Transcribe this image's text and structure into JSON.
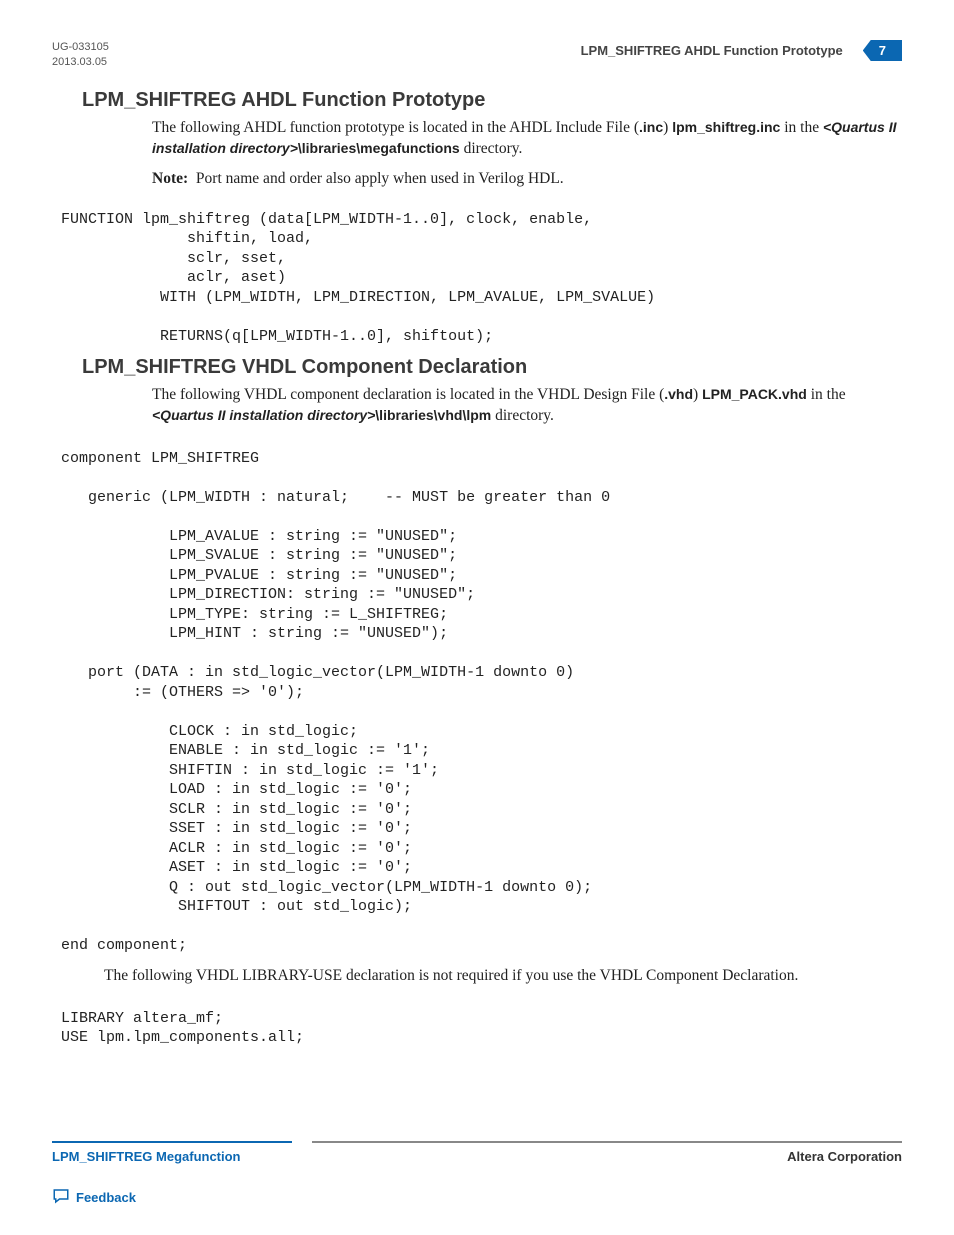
{
  "header": {
    "doc_id": "UG-033105",
    "date": "2013.03.05",
    "running_title": "LPM_SHIFTREG AHDL Function Prototype",
    "page_number": "7"
  },
  "section1": {
    "title": "LPM_SHIFTREG AHDL Function Prototype",
    "para_pre": "The following AHDL function prototype is located in the AHDL Include File (",
    "ext": ".inc",
    "para_mid1": ")  ",
    "file": "lpm_shiftreg.inc",
    "para_mid2": " in the ",
    "dir_emph": "<Quartus II installation directory>",
    "dir_tail": "\\libraries\\megafunctions",
    "para_post": " directory.",
    "note_label": "Note:",
    "note_text": "Port name and order also apply when used in Verilog HDL.",
    "code": " FUNCTION lpm_shiftreg (data[LPM_WIDTH-1..0], clock, enable,\n               shiftin, load,\n               sclr, sset,\n               aclr, aset)\n            WITH (LPM_WIDTH, LPM_DIRECTION, LPM_AVALUE, LPM_SVALUE)\n\n            RETURNS(q[LPM_WIDTH-1..0], shiftout);"
  },
  "section2": {
    "title": "LPM_SHIFTREG VHDL Component Declaration",
    "para_pre": "The following VHDL component declaration is located in the VHDL Design File (",
    "ext": ".vhd",
    "para_mid1": ")  ",
    "file": "LPM_PACK.vhd",
    "para_mid2": " in the ",
    "dir_emph": "<Quartus II installation directory>",
    "dir_tail": "\\libraries\\vhd\\lpm",
    "para_post": " directory.",
    "code": " component LPM_SHIFTREG\n\n    generic (LPM_WIDTH : natural;    -- MUST be greater than 0\n\n             LPM_AVALUE : string := \"UNUSED\";\n             LPM_SVALUE : string := \"UNUSED\";\n             LPM_PVALUE : string := \"UNUSED\";\n             LPM_DIRECTION: string := \"UNUSED\";\n             LPM_TYPE: string := L_SHIFTREG;\n             LPM_HINT : string := \"UNUSED\");\n\n    port (DATA : in std_logic_vector(LPM_WIDTH-1 downto 0)\n         := (OTHERS => '0');\n\n             CLOCK : in std_logic;\n             ENABLE : in std_logic := '1';\n             SHIFTIN : in std_logic := '1';\n             LOAD : in std_logic := '0';\n             SCLR : in std_logic := '0';\n             SSET : in std_logic := '0';\n             ACLR : in std_logic := '0';\n             ASET : in std_logic := '0';\n             Q : out std_logic_vector(LPM_WIDTH-1 downto 0);\n              SHIFTOUT : out std_logic);\n\n end component;",
    "para2": "The following VHDL LIBRARY-USE declaration is not required if you use the VHDL Component Declaration.",
    "code2": " LIBRARY altera_mf;\n USE lpm.lpm_components.all;"
  },
  "footer": {
    "left": "LPM_SHIFTREG Megafunction",
    "right": "Altera Corporation",
    "feedback": "Feedback"
  }
}
